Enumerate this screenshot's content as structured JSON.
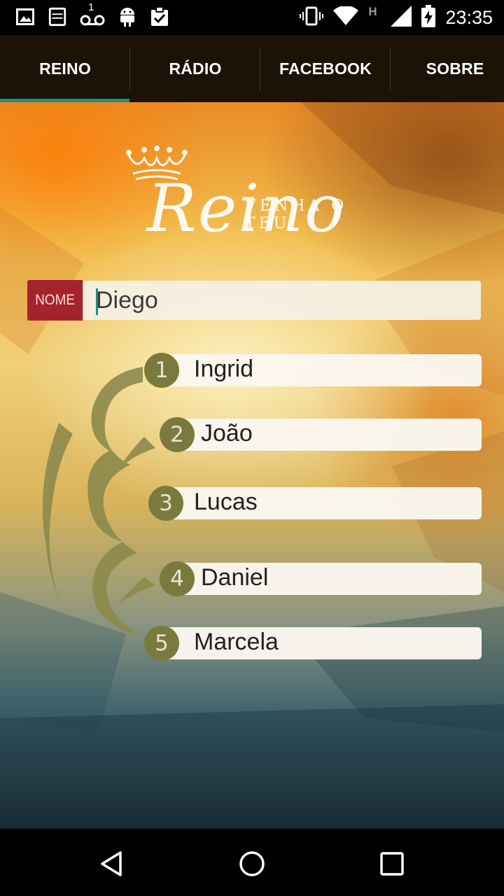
{
  "status_bar": {
    "time": "23:35",
    "left_icons": [
      "image-icon",
      "bible-app-icon",
      "voicemail-icon",
      "android-icon",
      "clipboard-check-icon"
    ],
    "voicemail_count": "1",
    "right_icons": [
      "vibrate-icon",
      "wifi-icon",
      "network-h-icon",
      "signal-icon",
      "battery-charging-icon"
    ],
    "network_type": "H"
  },
  "tabs": [
    {
      "label": "REINO",
      "selected": true
    },
    {
      "label": "RÁDIO",
      "selected": false
    },
    {
      "label": "FACEBOOK",
      "selected": false
    },
    {
      "label": "SOBRE",
      "selected": false
    }
  ],
  "logo": {
    "top_text": "VENHA O TEU",
    "main_text": "Reino"
  },
  "name_field": {
    "label": "NOME",
    "value": "Diego"
  },
  "list": [
    {
      "number": "1",
      "name": "Ingrid"
    },
    {
      "number": "2",
      "name": "João"
    },
    {
      "number": "3",
      "name": "Lucas"
    },
    {
      "number": "4",
      "name": "Daniel"
    },
    {
      "number": "5",
      "name": "Marcela"
    }
  ],
  "nav_bar": {
    "icons": [
      "back-icon",
      "home-icon",
      "recents-icon"
    ]
  },
  "colors": {
    "tab_bg": "#1c1207",
    "tab_indicator": "#1f8f80",
    "name_tag": "#a4242e",
    "number_badge": "#7a7a3e"
  }
}
